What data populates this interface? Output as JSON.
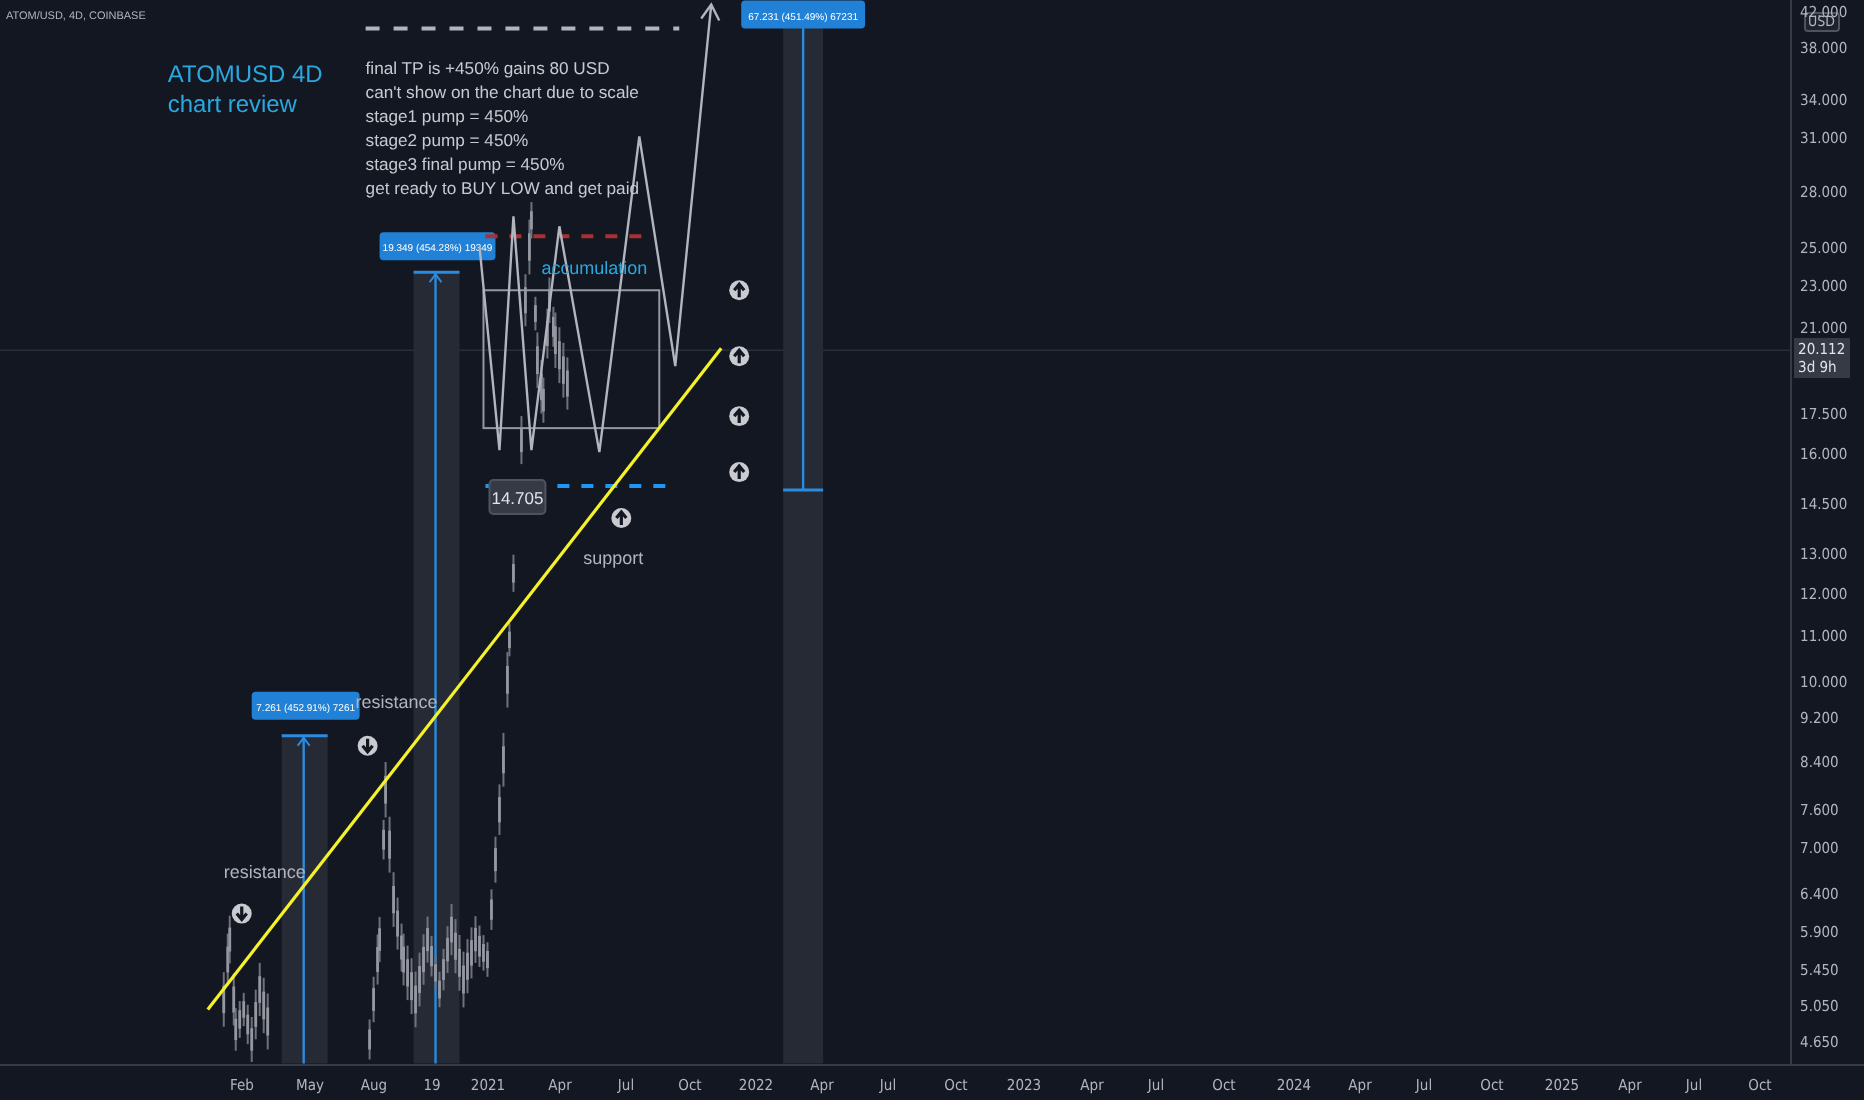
{
  "symbol_label": "ATOM/USD, 4D, COINBASE",
  "title_lines": [
    "ATOMUSD 4D",
    "chart review"
  ],
  "note_lines": [
    "final TP is +450% gains 80 USD",
    "can't show on the chart due to scale",
    "stage1 pump = 450%",
    "stage2 pump = 450%",
    "stage3 final pump = 450%",
    "get ready to BUY LOW and get paid"
  ],
  "annotations": [
    {
      "kind": "zone",
      "text": "accumulation"
    },
    {
      "kind": "level",
      "text": "support"
    },
    {
      "kind": "level",
      "text": "resistance"
    },
    {
      "kind": "level",
      "text": "resistance"
    }
  ],
  "measures": [
    {
      "text": "7.261 (452.91%) 7261"
    },
    {
      "text": "19.349 (454.28%) 19349"
    },
    {
      "text": "67.231 (451.49%) 67231"
    }
  ],
  "price_tag": "14.705",
  "price_axis": {
    "currency": "USD",
    "current_price": "20.112",
    "countdown": "3d 9h",
    "labels": [
      "42.000",
      "38.000",
      "34.000",
      "31.000",
      "28.000",
      "25.000",
      "23.000",
      "21.000",
      "17.500",
      "16.000",
      "14.500",
      "13.000",
      "12.000",
      "11.000",
      "10.000",
      "9.200",
      "8.400",
      "7.600",
      "7.000",
      "6.400",
      "5.900",
      "5.450",
      "5.050",
      "4.650"
    ]
  },
  "time_axis": {
    "labels": [
      "Feb",
      "May",
      "Aug",
      "19",
      "2021",
      "Apr",
      "Jul",
      "Oct",
      "2022",
      "Apr",
      "Jul",
      "Oct",
      "2023",
      "Apr",
      "Jul",
      "Oct",
      "2024",
      "Apr",
      "Jul",
      "Oct",
      "2025",
      "Apr",
      "Jul",
      "Oct"
    ]
  }
}
